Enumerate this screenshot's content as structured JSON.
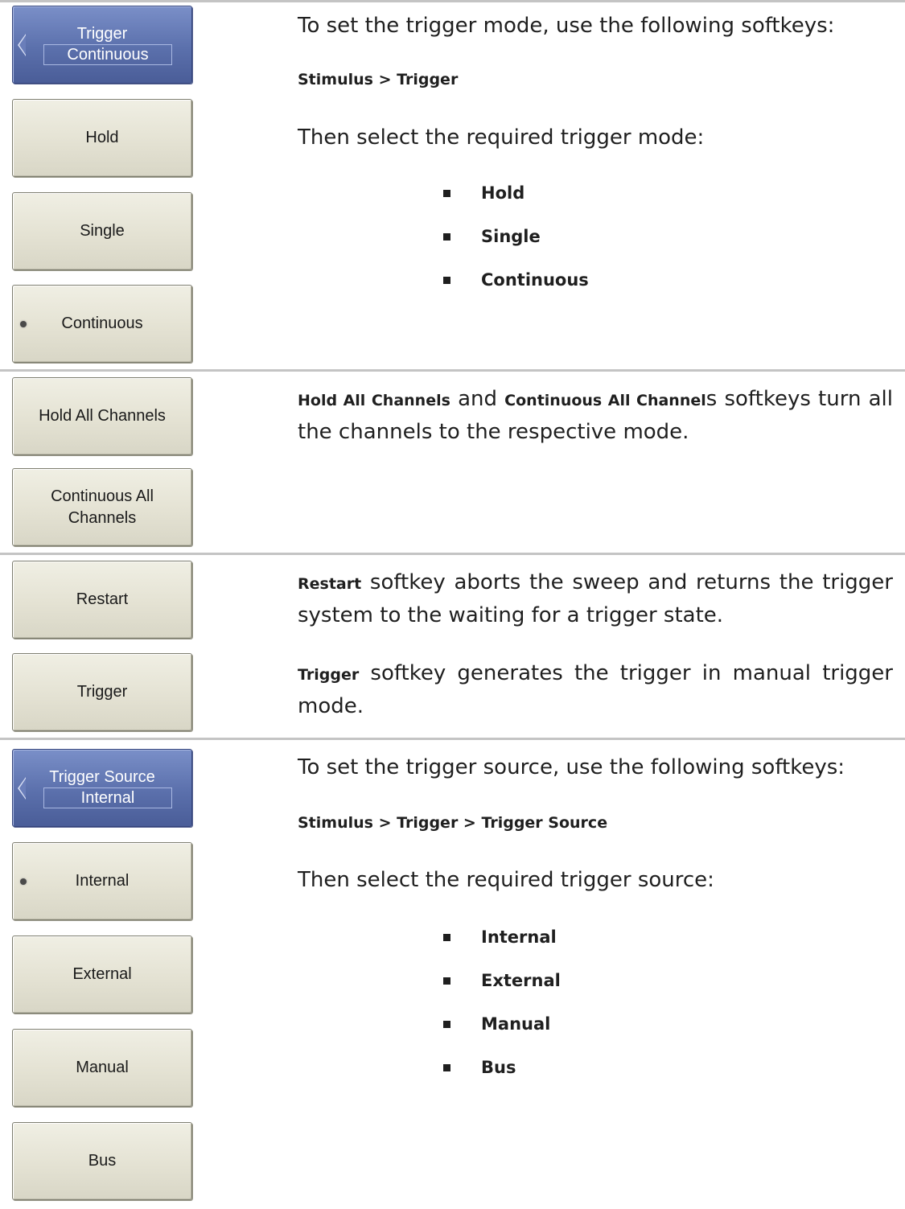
{
  "section1": {
    "header_key": {
      "title": "Trigger",
      "value": "Continuous"
    },
    "keys": [
      "Hold",
      "Single",
      "Continuous"
    ],
    "intro": "To set the trigger mode, use the following softkeys:",
    "path": "Stimulus > Trigger",
    "then": "Then select the required trigger mode:",
    "bullets": [
      "Hold",
      "Single",
      "Continuous"
    ]
  },
  "section2": {
    "keys": [
      "Hold All Channels",
      "Continuous All Channels"
    ],
    "bold1": "Hold All Channels",
    "and": " and ",
    "bold2": "Continuous All Channel",
    "rest": "s softkeys turn all the channels to the respective mode."
  },
  "section3": {
    "keys": [
      "Restart",
      "Trigger"
    ],
    "restart_bold": "Restart",
    "restart_text": " softkey aborts the sweep and returns the trigger system to the waiting for a trigger state.",
    "trigger_bold": "Trigger",
    "trigger_text": " softkey generates the trigger in manual trigger mode."
  },
  "section4": {
    "header_key": {
      "title": "Trigger Source",
      "value": "Internal"
    },
    "keys": [
      "Internal",
      "External",
      "Manual",
      "Bus"
    ],
    "intro": "To set the trigger source, use the following softkeys:",
    "path": "Stimulus > Trigger > Trigger Source",
    "then": "Then select the required trigger source:",
    "bullets": [
      "Internal",
      "External",
      "Manual",
      "Bus"
    ]
  }
}
